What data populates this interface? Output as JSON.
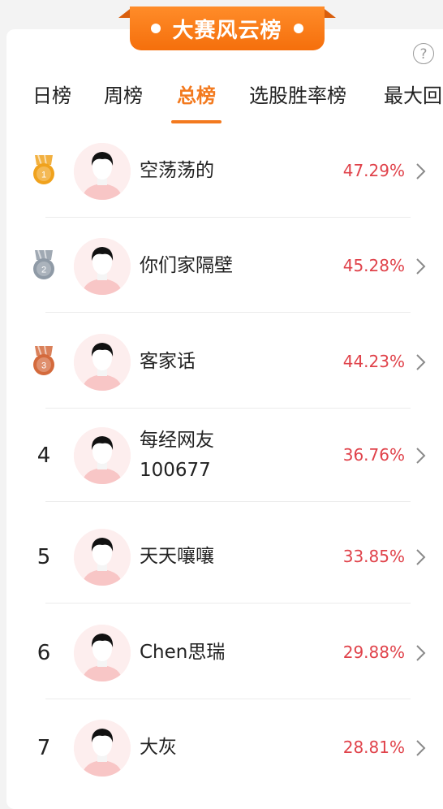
{
  "banner": {
    "title": "大赛风云榜"
  },
  "help": {
    "icon": "question-mark-icon",
    "glyph": "?"
  },
  "tabs": [
    {
      "label": "日榜"
    },
    {
      "label": "周榜"
    },
    {
      "label": "总榜",
      "active": true
    },
    {
      "label": "选股胜率榜"
    },
    {
      "label": "最大回"
    }
  ],
  "rows": [
    {
      "rank": "1",
      "medal": "gold",
      "name": "空荡荡的",
      "pct": "47.29%"
    },
    {
      "rank": "2",
      "medal": "silver",
      "name": "你们家隔壁",
      "pct": "45.28%"
    },
    {
      "rank": "3",
      "medal": "bronze",
      "name": "客家话",
      "pct": "44.23%"
    },
    {
      "rank": "4",
      "name": "每经网友\n100677",
      "pct": "36.76%"
    },
    {
      "rank": "5",
      "name": "天天嚷嚷",
      "pct": "33.85%"
    },
    {
      "rank": "6",
      "name": "Chen思瑞",
      "pct": "29.88%"
    },
    {
      "rank": "7",
      "name": "大灰",
      "pct": "28.81%"
    }
  ],
  "colors": {
    "accent": "#f37a1f",
    "percent": "#e0424a",
    "gold": "#f0a21d",
    "silver": "#8f9aa6",
    "bronze": "#d46a3c"
  }
}
